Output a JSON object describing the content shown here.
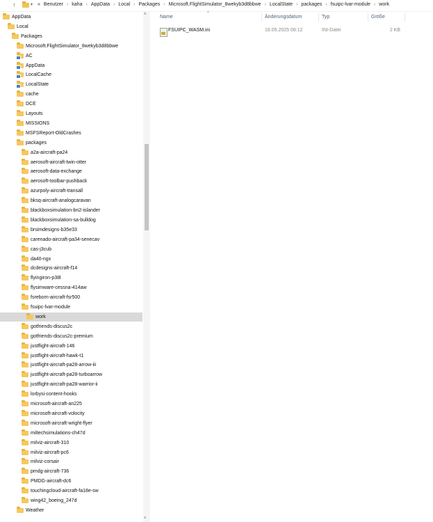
{
  "address_bar": {
    "prefix": "«",
    "crumbs": [
      "Benutzer",
      "kaha",
      "AppData",
      "Local",
      "Packages",
      "Microsoft.FlightSimulator_8wekyb3d8bbwe",
      "LocalState",
      "packages",
      "fsuipc-lvar-module",
      "work"
    ],
    "separator": "›"
  },
  "tree": {
    "items": [
      {
        "label": "AppData",
        "depth": 0,
        "icon": "folder-icon"
      },
      {
        "label": "Local",
        "depth": 1,
        "icon": "folder-icon"
      },
      {
        "label": "Packages",
        "depth": 2,
        "icon": "folder-icon"
      },
      {
        "label": "Microsoft.FlightSimulator_8wekyb3d8bbwe",
        "depth": 3,
        "icon": "folder-icon"
      },
      {
        "label": "AC",
        "depth": 4,
        "icon": "shared-folder-icon"
      },
      {
        "label": "AppData",
        "depth": 4,
        "icon": "shared-folder-icon"
      },
      {
        "label": "LocalCache",
        "depth": 4,
        "icon": "shared-folder-icon"
      },
      {
        "label": "LocalState",
        "depth": 4,
        "icon": "shared-folder-icon"
      },
      {
        "label": "cache",
        "depth": 5,
        "icon": "folder-icon"
      },
      {
        "label": "DCE",
        "depth": 5,
        "icon": "folder-icon"
      },
      {
        "label": "Layouts",
        "depth": 5,
        "icon": "folder-icon"
      },
      {
        "label": "MISSIONS",
        "depth": 5,
        "icon": "folder-icon"
      },
      {
        "label": "MSFSReport-OldCrashes",
        "depth": 5,
        "icon": "folder-icon"
      },
      {
        "label": "packages",
        "depth": 5,
        "icon": "folder-icon"
      },
      {
        "label": "a2a-aircraft-pa24",
        "depth": 6,
        "icon": "folder-icon"
      },
      {
        "label": "aerosoft-aircraft-twin-otter",
        "depth": 6,
        "icon": "folder-icon"
      },
      {
        "label": "aerosoft-data-exchange",
        "depth": 6,
        "icon": "folder-icon"
      },
      {
        "label": "aerosoft-toolbar-pushback",
        "depth": 6,
        "icon": "folder-icon"
      },
      {
        "label": "azurpoly-aircraft-transall",
        "depth": 6,
        "icon": "folder-icon"
      },
      {
        "label": "bksq-aircraft-analogcaravan",
        "depth": 6,
        "icon": "folder-icon"
      },
      {
        "label": "blackboxsimulation-bn2-islander",
        "depth": 6,
        "icon": "folder-icon"
      },
      {
        "label": "blackboxsimulation-sa-bulldog",
        "depth": 6,
        "icon": "folder-icon"
      },
      {
        "label": "brsimdesigns-b35e33",
        "depth": 6,
        "icon": "folder-icon"
      },
      {
        "label": "carenado-aircraft-pa34-senecav",
        "depth": 6,
        "icon": "folder-icon"
      },
      {
        "label": "cas-j3cub",
        "depth": 6,
        "icon": "folder-icon"
      },
      {
        "label": "da40-ngx",
        "depth": 6,
        "icon": "folder-icon"
      },
      {
        "label": "dcdesigns-aircraft-f14",
        "depth": 6,
        "icon": "folder-icon"
      },
      {
        "label": "flyingiron-p38l",
        "depth": 6,
        "icon": "folder-icon"
      },
      {
        "label": "flysimware-cessna-414aw",
        "depth": 6,
        "icon": "folder-icon"
      },
      {
        "label": "fsreborn-aircraft-fsr500",
        "depth": 6,
        "icon": "folder-icon"
      },
      {
        "label": "fsuipc-lvar-module",
        "depth": 6,
        "icon": "folder-icon"
      },
      {
        "label": "work",
        "depth": 7,
        "icon": "folder-icon",
        "selected": true
      },
      {
        "label": "gotfriends-discus2c",
        "depth": 6,
        "icon": "folder-icon"
      },
      {
        "label": "gotfriends-discus2c-premium",
        "depth": 6,
        "icon": "folder-icon"
      },
      {
        "label": "justflight-aircraft-146",
        "depth": 6,
        "icon": "folder-icon"
      },
      {
        "label": "justflight-aircraft-hawk-t1",
        "depth": 6,
        "icon": "folder-icon"
      },
      {
        "label": "justflight-aircraft-pa28-arrow-iii",
        "depth": 6,
        "icon": "folder-icon"
      },
      {
        "label": "justflight-aircraft-pa28-turboarrow",
        "depth": 6,
        "icon": "folder-icon"
      },
      {
        "label": "justflight-aircraft-pa28-warrior-ii",
        "depth": 6,
        "icon": "folder-icon"
      },
      {
        "label": "lorbysi-content-hooks",
        "depth": 6,
        "icon": "folder-icon"
      },
      {
        "label": "microsoft-aircraft-an225",
        "depth": 6,
        "icon": "folder-icon"
      },
      {
        "label": "microsoft-aircraft-volocity",
        "depth": 6,
        "icon": "folder-icon"
      },
      {
        "label": "microsoft-aircraft-wright-flyer",
        "depth": 6,
        "icon": "folder-icon"
      },
      {
        "label": "miltechsimulations-ch47d",
        "depth": 6,
        "icon": "folder-icon"
      },
      {
        "label": "milviz-aircraft-310",
        "depth": 6,
        "icon": "folder-icon"
      },
      {
        "label": "milviz-aircraft-pc6",
        "depth": 6,
        "icon": "folder-icon"
      },
      {
        "label": "milviz-corsair",
        "depth": 6,
        "icon": "folder-icon"
      },
      {
        "label": "pmdg-aircraft-736",
        "depth": 6,
        "icon": "folder-icon"
      },
      {
        "label": "PMDG-aircraft-dc6",
        "depth": 6,
        "icon": "folder-icon"
      },
      {
        "label": "touchingcloud-aircraft-fa18e-sw",
        "depth": 6,
        "icon": "folder-icon"
      },
      {
        "label": "wing42_boeing_247d",
        "depth": 6,
        "icon": "folder-icon"
      },
      {
        "label": "Weather",
        "depth": 5,
        "icon": "folder-icon"
      }
    ]
  },
  "columns": {
    "name": "Name",
    "date": "Änderungsdatum",
    "type": "Typ",
    "size": "Größe"
  },
  "files": [
    {
      "name": "FSUIPC_WASM.ini",
      "date": "16.05.2025 08:12",
      "type": "INI-Datei",
      "size": "2 KB",
      "icon": "ini-file-icon"
    }
  ]
}
